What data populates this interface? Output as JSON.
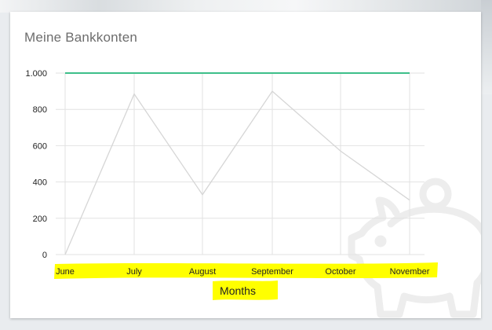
{
  "card": {
    "title": "Meine Bankkonten"
  },
  "icons": {
    "watermark": "piggy-bank-icon"
  },
  "colors": {
    "threshold_line": "#3dbf8a",
    "data_line": "#d6d6d6",
    "grid": "#e2e2e2",
    "highlight": "#ffff00"
  },
  "chart_data": {
    "type": "line",
    "title": "",
    "xlabel": "Months",
    "ylabel": "",
    "categories": [
      "June",
      "July",
      "August",
      "September",
      "October",
      "November"
    ],
    "ylim": [
      0,
      1000
    ],
    "yticks": [
      0,
      200,
      400,
      600,
      800,
      1000
    ],
    "ytick_labels": [
      "0",
      "200",
      "400",
      "600",
      "800",
      "1.000"
    ],
    "series": [
      {
        "values": [
          0,
          885,
          330,
          900,
          570,
          300
        ]
      },
      {
        "values": [
          1000,
          1000,
          1000,
          1000,
          1000,
          1000
        ]
      }
    ],
    "grid": true,
    "legend": "none",
    "highlight": "x-axis labels and axis title highlighted in yellow"
  }
}
